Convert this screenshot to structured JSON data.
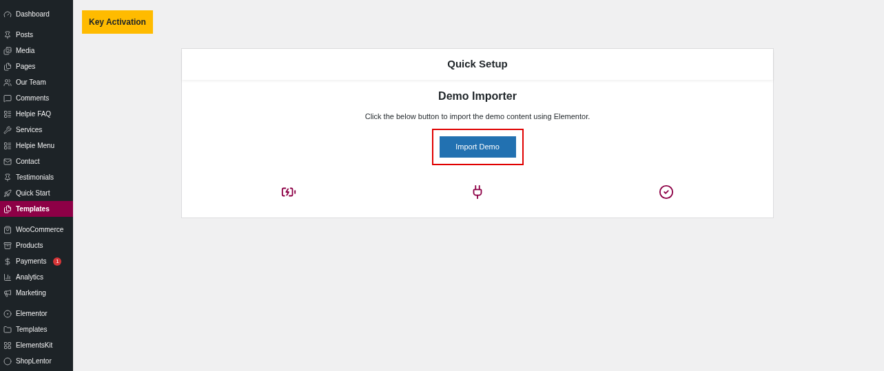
{
  "sidebar": {
    "groups": [
      {
        "items": [
          {
            "label": "Dashboard",
            "selected": false
          }
        ]
      },
      {
        "items": [
          {
            "label": "Posts",
            "selected": false
          },
          {
            "label": "Media",
            "selected": false
          },
          {
            "label": "Pages",
            "selected": false
          },
          {
            "label": "Our Team",
            "selected": false
          },
          {
            "label": "Comments",
            "selected": false
          },
          {
            "label": "Helpie FAQ",
            "selected": false
          },
          {
            "label": "Services",
            "selected": false
          },
          {
            "label": "Helpie Menu",
            "selected": false
          },
          {
            "label": "Contact",
            "selected": false
          },
          {
            "label": "Testimonials",
            "selected": false
          },
          {
            "label": "Quick Start",
            "selected": false
          },
          {
            "label": "Templates",
            "selected": true
          }
        ]
      },
      {
        "items": [
          {
            "label": "WooCommerce",
            "selected": false
          },
          {
            "label": "Products",
            "selected": false
          },
          {
            "label": "Payments",
            "selected": false,
            "badge": "1"
          },
          {
            "label": "Analytics",
            "selected": false
          },
          {
            "label": "Marketing",
            "selected": false
          }
        ]
      },
      {
        "items": [
          {
            "label": "Elementor",
            "selected": false
          },
          {
            "label": "Templates",
            "selected": false
          },
          {
            "label": "ElementsKit",
            "selected": false
          },
          {
            "label": "ShopLentor",
            "selected": false
          }
        ]
      }
    ]
  },
  "key_activation": {
    "label": "Key Activation"
  },
  "card": {
    "title": "Quick Setup",
    "heading": "Demo Importer",
    "description": "Click the below button to import the demo content using Elementor.",
    "button": {
      "label": "Import Demo",
      "highlighted": true
    }
  }
}
